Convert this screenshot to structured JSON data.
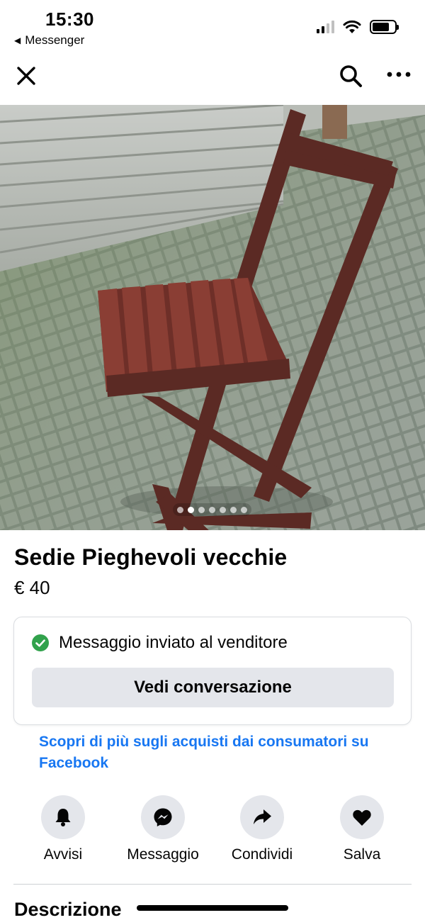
{
  "status_bar": {
    "time": "15:30",
    "back_app": "Messenger",
    "icons": [
      "cellular-signal-icon",
      "wifi-icon",
      "battery-icon"
    ]
  },
  "nav": {
    "icons": [
      "close-icon",
      "search-icon",
      "more-options-icon"
    ]
  },
  "listing": {
    "photo_count": 7,
    "active_photo": 2,
    "title": "Sedie Pieghevoli vecchie",
    "price": "€ 40"
  },
  "notice": {
    "text": "Messaggio inviato al venditore",
    "button": "Vedi conversazione",
    "icon": "check-circle-icon",
    "icon_color": "#31a24c"
  },
  "learn_more": {
    "text": "Scopri di più sugli acquisti dai consumatori su Facebook",
    "color": "#1877f2"
  },
  "actions": [
    {
      "label": "Avvisi",
      "icon": "bell-icon"
    },
    {
      "label": "Messaggio",
      "icon": "messenger-icon"
    },
    {
      "label": "Condividi",
      "icon": "share-icon"
    },
    {
      "label": "Salva",
      "icon": "heart-icon"
    }
  ],
  "section": {
    "title": "Descrizione"
  }
}
